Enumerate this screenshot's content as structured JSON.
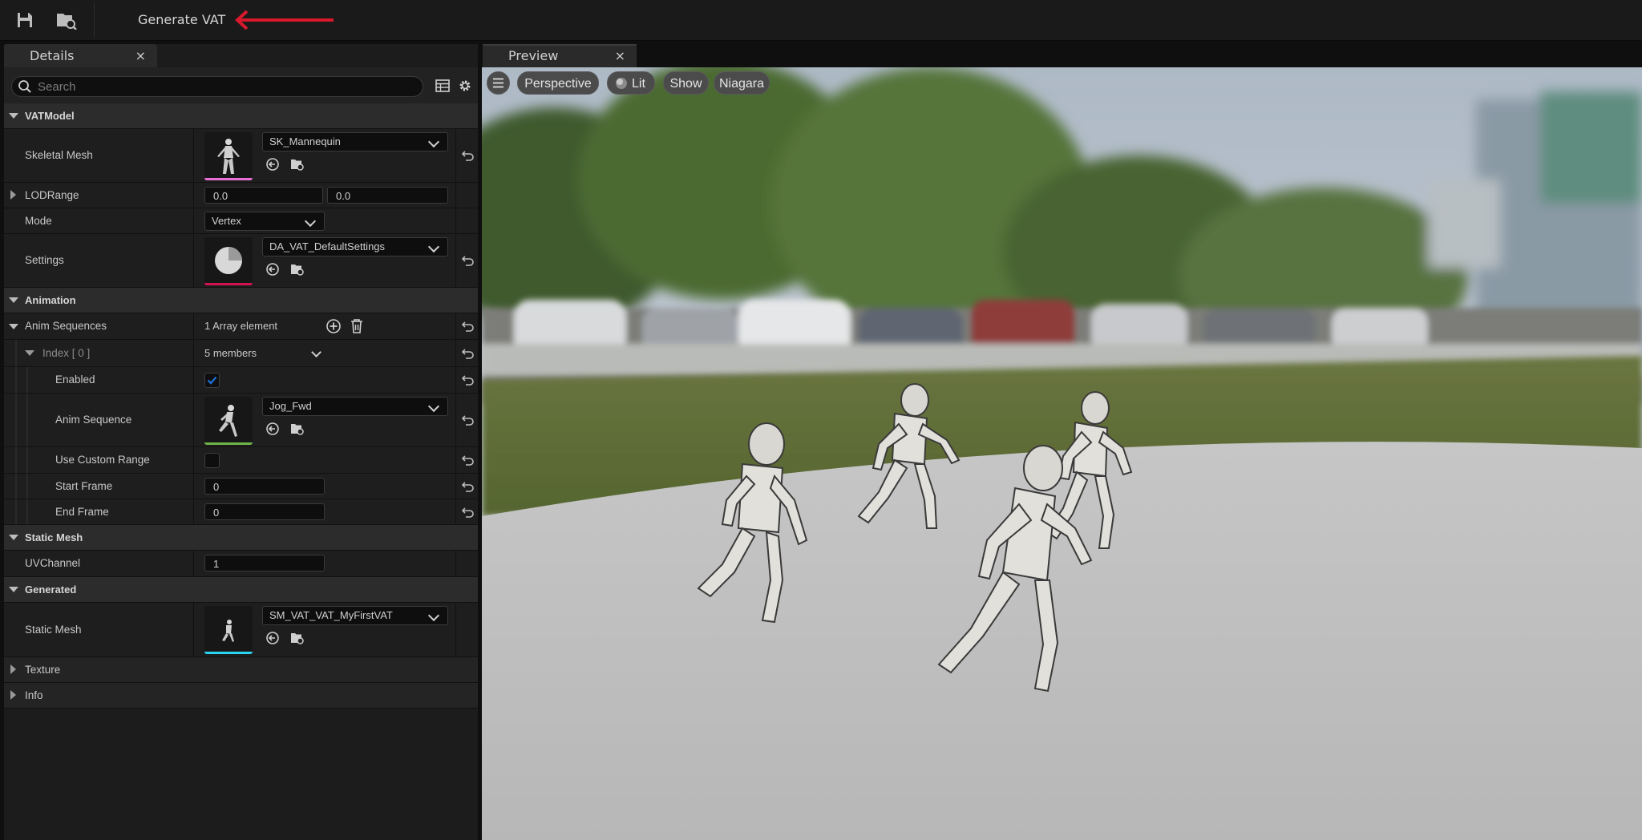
{
  "toolbar": {
    "save_icon": "save-icon",
    "browse_icon": "browse-icon",
    "generate_label": "Generate VAT",
    "annotation_color": "#d7192b"
  },
  "details": {
    "tab_label": "Details",
    "close": "×",
    "search_placeholder": "Search",
    "categories": {
      "vatmodel": "VATModel",
      "animation": "Animation",
      "static_mesh": "Static Mesh",
      "generated": "Generated",
      "texture": "Texture",
      "info": "Info"
    },
    "vatmodel": {
      "skeletal_mesh_label": "Skeletal Mesh",
      "skeletal_mesh_value": "SK_Mannequin",
      "lodrange_label": "LODRange",
      "lod_min": "0.0",
      "lod_max": "0.0",
      "mode_label": "Mode",
      "mode_value": "Vertex",
      "settings_label": "Settings",
      "settings_value": "DA_VAT_DefaultSettings"
    },
    "animation": {
      "anim_sequences_label": "Anim Sequences",
      "array_count": "1 Array element",
      "index_label": "Index [ 0 ]",
      "members": "5 members",
      "enabled_label": "Enabled",
      "enabled_checked": true,
      "anim_sequence_label": "Anim Sequence",
      "anim_sequence_value": "Jog_Fwd",
      "use_custom_range_label": "Use Custom Range",
      "use_custom_range_checked": false,
      "start_frame_label": "Start Frame",
      "start_frame_value": "0",
      "end_frame_label": "End Frame",
      "end_frame_value": "0"
    },
    "static_mesh": {
      "uvchannel_label": "UVChannel",
      "uvchannel_value": "1"
    },
    "generated": {
      "static_mesh_label": "Static Mesh",
      "static_mesh_value": "SM_VAT_VAT_MyFirstVAT"
    },
    "colors": {
      "skeletal_bar": "#e86fd6",
      "settings_bar": "#d4124f",
      "anim_bar": "#6fb34a",
      "static_bar": "#2ad3f0",
      "check_blue": "#1f6ed4"
    }
  },
  "preview": {
    "tab_label": "Preview",
    "close": "×",
    "buttons": {
      "perspective": "Perspective",
      "lit": "Lit",
      "show": "Show",
      "niagara": "Niagara"
    }
  }
}
